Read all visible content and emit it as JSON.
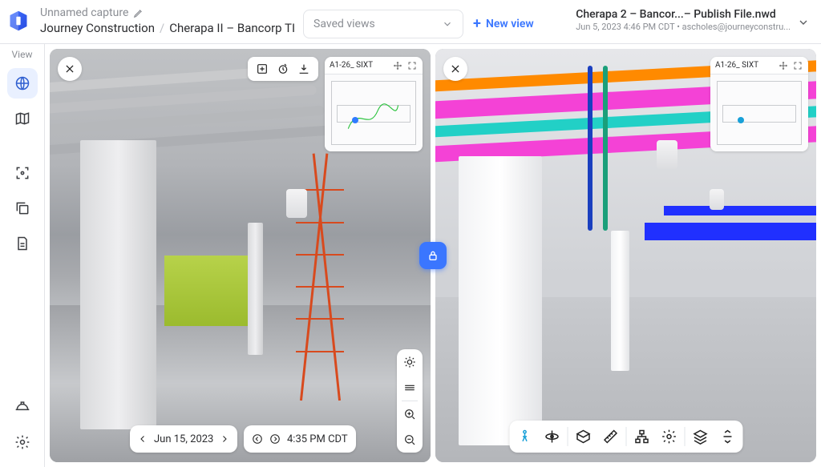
{
  "header": {
    "capture_name": "Unnamed capture",
    "breadcrumb": {
      "org": "Journey Construction",
      "project": "Cherapa II – Bancorp TI"
    },
    "saved_views_label": "Saved views",
    "new_view_label": "New view",
    "file": {
      "title": "Cherapa 2 – Bancor...– Publish File.nwd",
      "meta": "Jun 5, 2023 4:46 PM CDT • ascholes@journeyconstru..."
    }
  },
  "sidebar": {
    "label": "View"
  },
  "left_pane": {
    "minimap_title": "A1-26_ SIXT",
    "date": "Jun 15, 2023",
    "time": "4:35 PM CDT"
  },
  "right_pane": {
    "minimap_title": "A1-26_ SIXT"
  }
}
